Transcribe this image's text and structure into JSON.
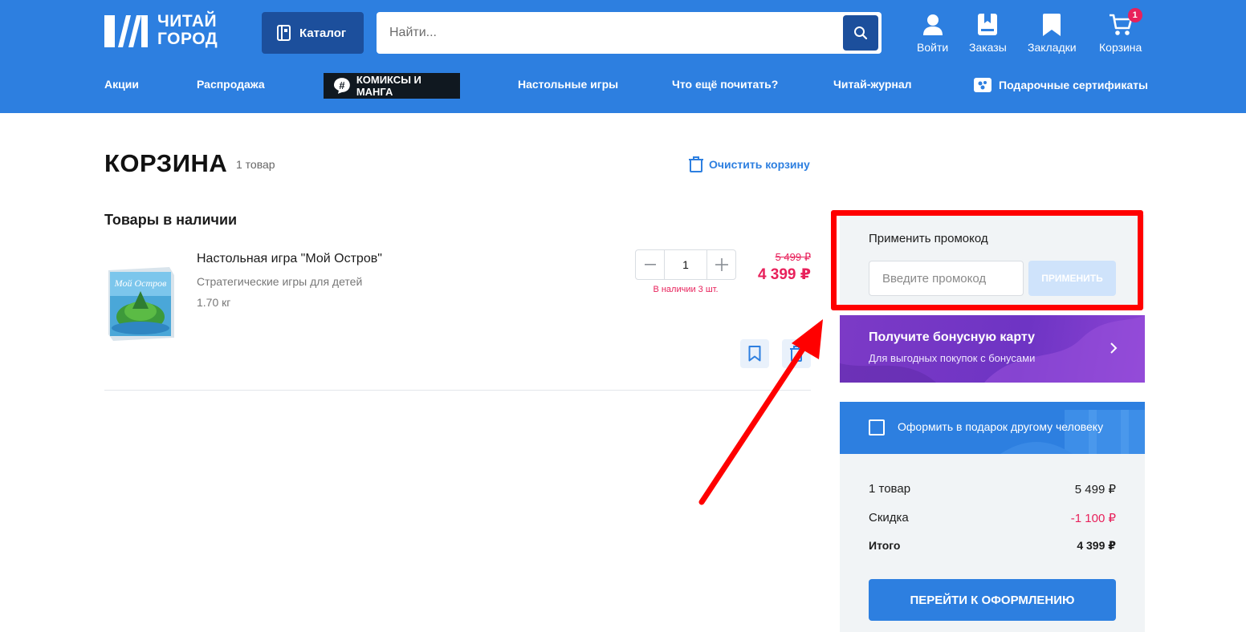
{
  "header": {
    "logo_line1": "ЧИТАЙ",
    "logo_line2": "ГОРОД",
    "catalog_label": "Каталог",
    "search_placeholder": "Найти...",
    "actions": {
      "login": "Войти",
      "orders": "Заказы",
      "bookmarks": "Закладки",
      "cart": "Корзина",
      "cart_badge": "1"
    },
    "nav": {
      "promotions": "Акции",
      "sale": "Распродажа",
      "comics": "КОМИКСЫ И МАНГА",
      "board_games": "Настольные игры",
      "what_to_read": "Что ещё почитать?",
      "journal": "Читай-журнал",
      "gift_cards": "Подарочные сертификаты"
    }
  },
  "cart": {
    "title": "КОРЗИНА",
    "count": "1 товар",
    "clear_label": "Очистить корзину",
    "section_title": "Товары в наличии",
    "item": {
      "name": "Настольная игра \"Мой Остров\"",
      "category": "Стратегические игры для детей",
      "weight": "1.70 кг",
      "quantity": "1",
      "stock": "В наличии 3 шт.",
      "old_price": "5 499 ₽",
      "price": "4 399 ₽",
      "box_art_text": "Мой Остров"
    }
  },
  "sidebar": {
    "promo_title": "Применить промокод",
    "promo_placeholder": "Введите промокод",
    "promo_button": "ПРИМЕНИТЬ",
    "bonus_title": "Получите бонусную карту",
    "bonus_subtitle": "Для выгодных покупок с бонусами",
    "gift_label": "Оформить в подарок другому человеку",
    "summary": {
      "items_label": "1 товар",
      "items_value": "5 499 ₽",
      "discount_label": "Скидка",
      "discount_value": "-1 100 ₽",
      "total_label": "Итого",
      "total_value": "4 399 ₽"
    },
    "checkout_button": "ПЕРЕЙТИ К ОФОРМЛЕНИЮ"
  },
  "colors": {
    "brand_blue": "#2d7fe0",
    "dark_blue": "#1c4f9c",
    "price_red": "#e8215b",
    "annotation_red": "#ff0000",
    "bonus_purple": "#7c3ac6"
  }
}
